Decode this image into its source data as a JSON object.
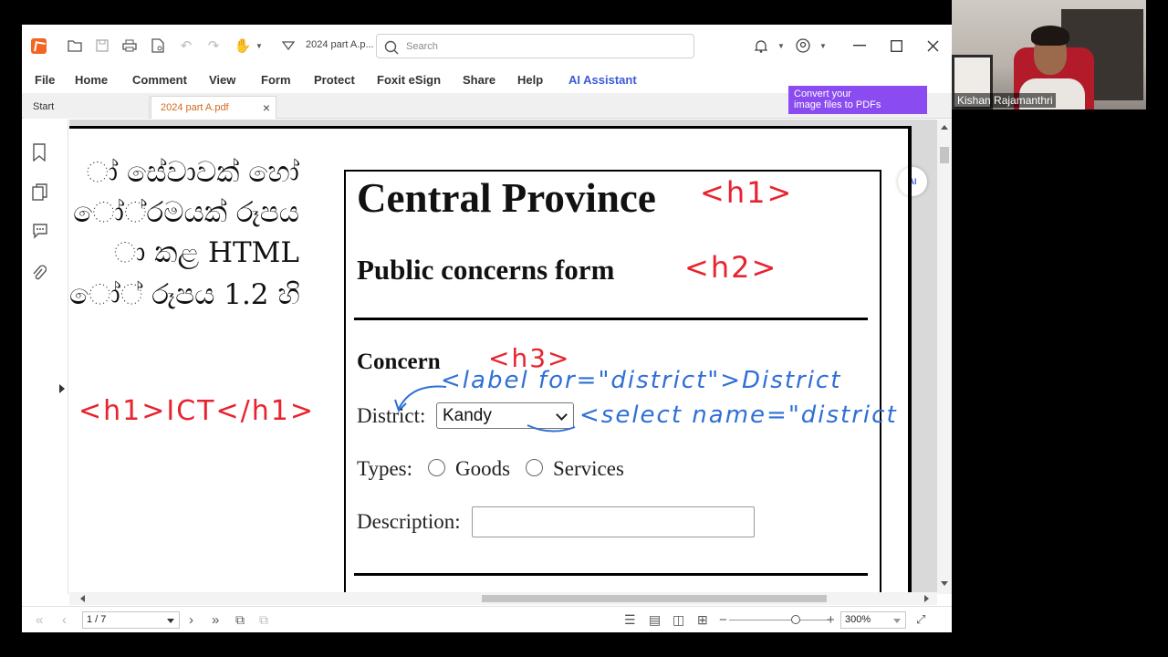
{
  "app": {
    "title_doc": "2024 part A.p...",
    "search_placeholder": "Search",
    "menu": [
      "File",
      "Home",
      "Comment",
      "View",
      "Form",
      "Protect",
      "Foxit eSign",
      "Share",
      "Help",
      "AI Assistant"
    ],
    "tabs": [
      {
        "label": "Start",
        "active": false
      },
      {
        "label": "2024 part A.pdf",
        "active": true
      }
    ],
    "banner": {
      "line1": "Convert your",
      "line2": "image files to PDFs"
    }
  },
  "document": {
    "sinhala_lines": [
      "ා් සේවාවක් හෝ",
      "ෝ්රමයක් රූපය",
      "ා කළ HTML",
      "ෝ් රූපය 1.2 හි"
    ],
    "form": {
      "h1": "Central Province",
      "h2": "Public concerns form",
      "h3": "Concern",
      "district_label": "District:",
      "district_value": "Kandy",
      "types_label": "Types:",
      "option_goods": "Goods",
      "option_services": "Services",
      "description_label": "Description:"
    },
    "annotations": {
      "h1_tag": "<h1>",
      "h2_tag": "<h2>",
      "h3_tag": "<h3>",
      "label_code": "<label for=\"district\">District",
      "select_code": "<select name=\"district",
      "left_code": "<h1>ICT</h1>"
    },
    "ai_badge": "AI"
  },
  "status": {
    "page": "1 / 7",
    "zoom": "300%"
  },
  "webcam": {
    "name": "Kishan Rajamanthri"
  },
  "colors": {
    "accent_orange": "#f26522",
    "ai_blue": "#3d5ad6",
    "banner_purple": "#8a4cf0",
    "annotation_red": "#e8232f",
    "annotation_blue": "#2f6fd6"
  }
}
